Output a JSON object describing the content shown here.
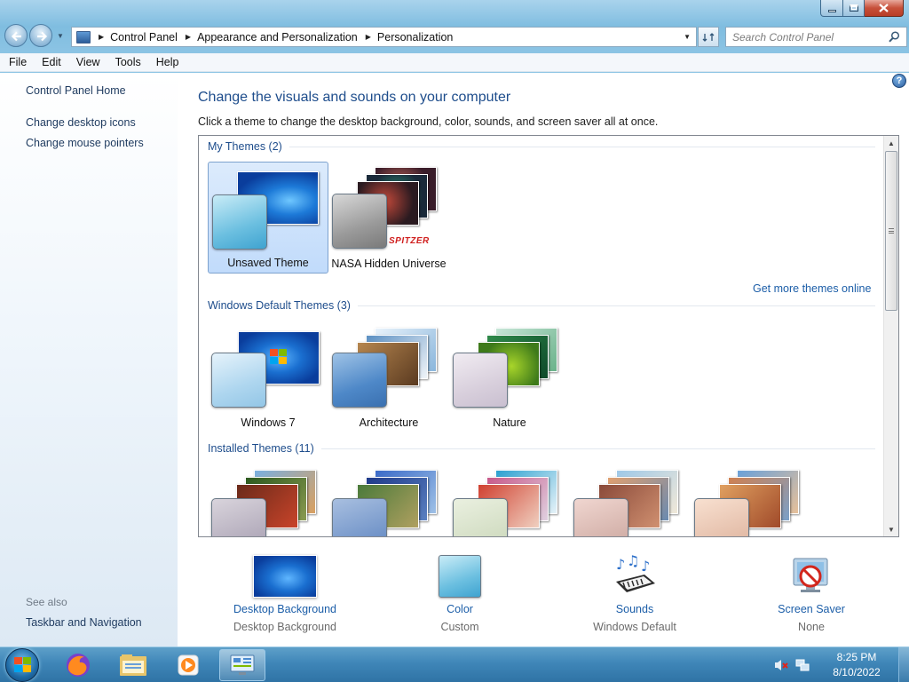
{
  "window": {
    "breadcrumbs": [
      "Control Panel",
      "Appearance and Personalization",
      "Personalization"
    ],
    "search_placeholder": "Search Control Panel"
  },
  "menu": [
    "File",
    "Edit",
    "View",
    "Tools",
    "Help"
  ],
  "sidebar": {
    "home": "Control Panel Home",
    "links": [
      "Change desktop icons",
      "Change mouse pointers"
    ],
    "see_also_label": "See also",
    "see_also_links": [
      "Taskbar and Navigation"
    ]
  },
  "main": {
    "title": "Change the visuals and sounds on your computer",
    "subtitle": "Click a theme to change the desktop background, color, sounds, and screen saver all at once."
  },
  "themes": {
    "groups": [
      {
        "heading": "My Themes (2)",
        "items": [
          "Unsaved Theme",
          "NASA Hidden Universe"
        ],
        "selected": "Unsaved Theme"
      },
      {
        "heading": "Windows Default Themes (3)",
        "items": [
          "Windows 7",
          "Architecture",
          "Nature"
        ]
      },
      {
        "heading": "Installed Themes (11)",
        "items": []
      }
    ],
    "get_more_link": "Get more themes online",
    "nasa_logo_text": "SPITZER"
  },
  "settings": [
    {
      "link": "Desktop Background",
      "value": "Desktop Background",
      "icon": "desktop-background-icon"
    },
    {
      "link": "Color",
      "value": "Custom",
      "icon": "window-color-icon"
    },
    {
      "link": "Sounds",
      "value": "Windows Default",
      "icon": "sounds-icon"
    },
    {
      "link": "Screen Saver",
      "value": "None",
      "icon": "screen-saver-icon"
    }
  ],
  "taskbar": {
    "apps": [
      "start-orb",
      "firefox-icon",
      "windows-explorer-icon",
      "media-player-icon",
      "control-panel-icon"
    ],
    "time": "8:25 PM",
    "date": "8/10/2022"
  },
  "colors": {
    "accent_link": "#1c5ea8",
    "heading_blue": "#1e4d8c",
    "taskbar": "#3f86b8"
  }
}
